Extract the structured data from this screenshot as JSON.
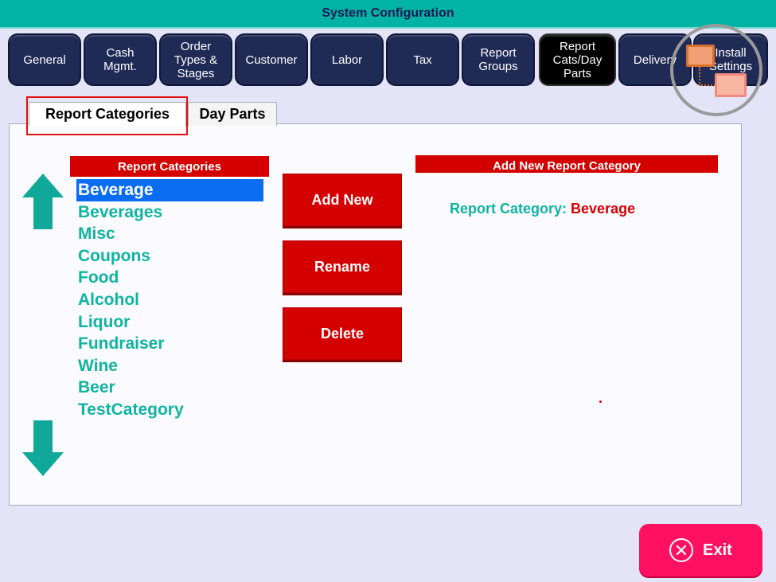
{
  "window": {
    "title": "System Configuration"
  },
  "tabs": [
    {
      "label": "General",
      "active": false
    },
    {
      "label": "Cash\nMgmt.",
      "active": false
    },
    {
      "label": "Order\nTypes &\nStages",
      "active": false
    },
    {
      "label": "Customer",
      "active": false
    },
    {
      "label": "Labor",
      "active": false
    },
    {
      "label": "Tax",
      "active": false
    },
    {
      "label": "Report\nGroups",
      "active": false
    },
    {
      "label": "Report\nCats/Day\nParts",
      "active": true
    },
    {
      "label": "Delivery",
      "active": false
    },
    {
      "label": "Install\nSettings",
      "active": false
    }
  ],
  "subtabs": [
    {
      "label": "Report Categories",
      "active": true
    },
    {
      "label": "Day Parts",
      "active": false
    }
  ],
  "list": {
    "header": "Report Categories",
    "items": [
      "Beverage",
      "Beverages",
      "Misc",
      "Coupons",
      "Food",
      "Alcohol",
      "Liquor",
      "Fundraiser",
      "Wine",
      "Beer",
      "TestCategory"
    ],
    "selected": "Beverage"
  },
  "actions": {
    "add_new": "Add New",
    "rename": "Rename",
    "delete": "Delete"
  },
  "detail": {
    "header": "Add New Report Category",
    "label": "Report Category:",
    "value": "Beverage"
  },
  "footer": {
    "exit": "Exit"
  },
  "colors": {
    "titlebar": "#00b3a3",
    "tab": "#1f2a55",
    "accent_red": "#d40000",
    "teal_text": "#10b3a0",
    "selection": "#0a6cf0",
    "exit": "#ff1060"
  },
  "icons": [
    "arrow-up-icon",
    "arrow-down-icon",
    "close-circle-icon",
    "install-monitors-icon"
  ]
}
